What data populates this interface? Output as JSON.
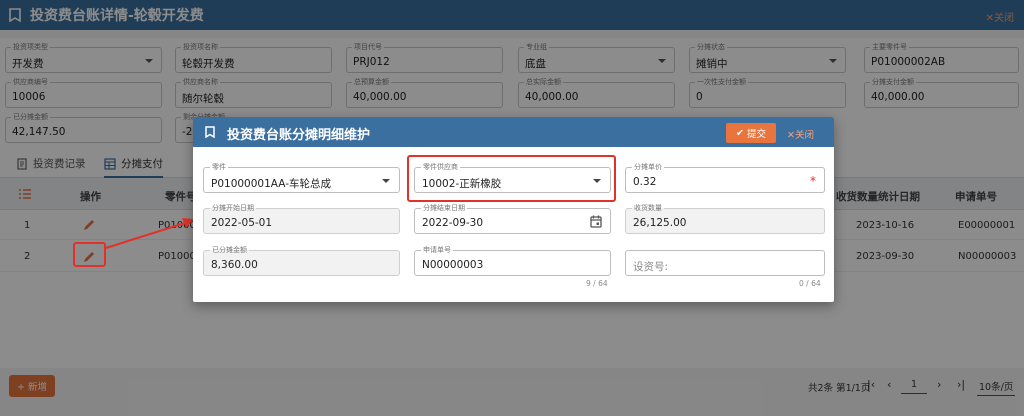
{
  "page": {
    "title": "投资费台账详情-轮毂开发费",
    "close_label": "关闭"
  },
  "form": {
    "fields": [
      {
        "label": "投资项类型",
        "value": "开发费",
        "dropdown": true
      },
      {
        "label": "投资项名称",
        "value": "轮毂开发费"
      },
      {
        "label": "项目代号",
        "value": "PRJ012"
      },
      {
        "label": "专业组",
        "value": "底盘",
        "dropdown": true
      },
      {
        "label": "分摊状态",
        "value": "摊销中",
        "dropdown": true
      },
      {
        "label": "主要零件号",
        "value": "P01000002AB"
      },
      {
        "label": "供应商编号",
        "value": "10006"
      },
      {
        "label": "供应商名称",
        "value": "随尔轮毂"
      },
      {
        "label": "总预算金额",
        "value": "40,000.00"
      },
      {
        "label": "总实际金额",
        "value": "40,000.00"
      },
      {
        "label": "一次性支付金额",
        "value": "0"
      },
      {
        "label": "分摊支付金额",
        "value": "40,000.00"
      },
      {
        "label": "已分摊金额",
        "value": "42,147.50"
      },
      {
        "label": "剩余分摊金额",
        "value": "-2"
      }
    ]
  },
  "tabs": [
    {
      "label": "投资费记录"
    },
    {
      "label": "分摊支付"
    }
  ],
  "grid": {
    "headers": {
      "op": "操作",
      "part": "零件号",
      "date": "收货数量统计日期",
      "apply": "申请单号"
    },
    "rows": [
      {
        "index": "1",
        "part": "P010000",
        "date": "2023-10-16",
        "apply": "E00000001"
      },
      {
        "index": "2",
        "part": "P010000",
        "date": "2023-09-30",
        "apply": "N00000003"
      }
    ]
  },
  "footer": {
    "add_label": "+ 新增",
    "summary": "共2条 第1/1页",
    "page": "1",
    "page_size": "10条/页"
  },
  "modal": {
    "title": "投资费台账分摊明细维护",
    "submit_label": "提交",
    "close_label": "关闭",
    "fields": {
      "part": {
        "label": "零件",
        "value": "P01000001AA-车轮总成"
      },
      "supplier": {
        "label": "零件供应商",
        "value": "10002-正新橡胶"
      },
      "unit_price": {
        "label": "分摊单价",
        "value": "0.32",
        "required": "*"
      },
      "start_date": {
        "label": "分摊开始日期",
        "value": "2022-05-01"
      },
      "end_date": {
        "label": "分摊结束日期",
        "value": "2022-09-30"
      },
      "recv_qty": {
        "label": "收货数量",
        "value": "26,125.00"
      },
      "shared_amount": {
        "label": "已分摊金额",
        "value": "8,360.00"
      },
      "apply_no": {
        "label": "申请单号",
        "value": "N00000003",
        "count": "9 / 64"
      },
      "invest_no": {
        "placeholder": "设资号:",
        "count": "0 / 64"
      }
    }
  },
  "colors": {
    "header_blue": "#3b6fa0",
    "accent_orange": "#e8753d",
    "highlight_red": "#e0322a"
  }
}
